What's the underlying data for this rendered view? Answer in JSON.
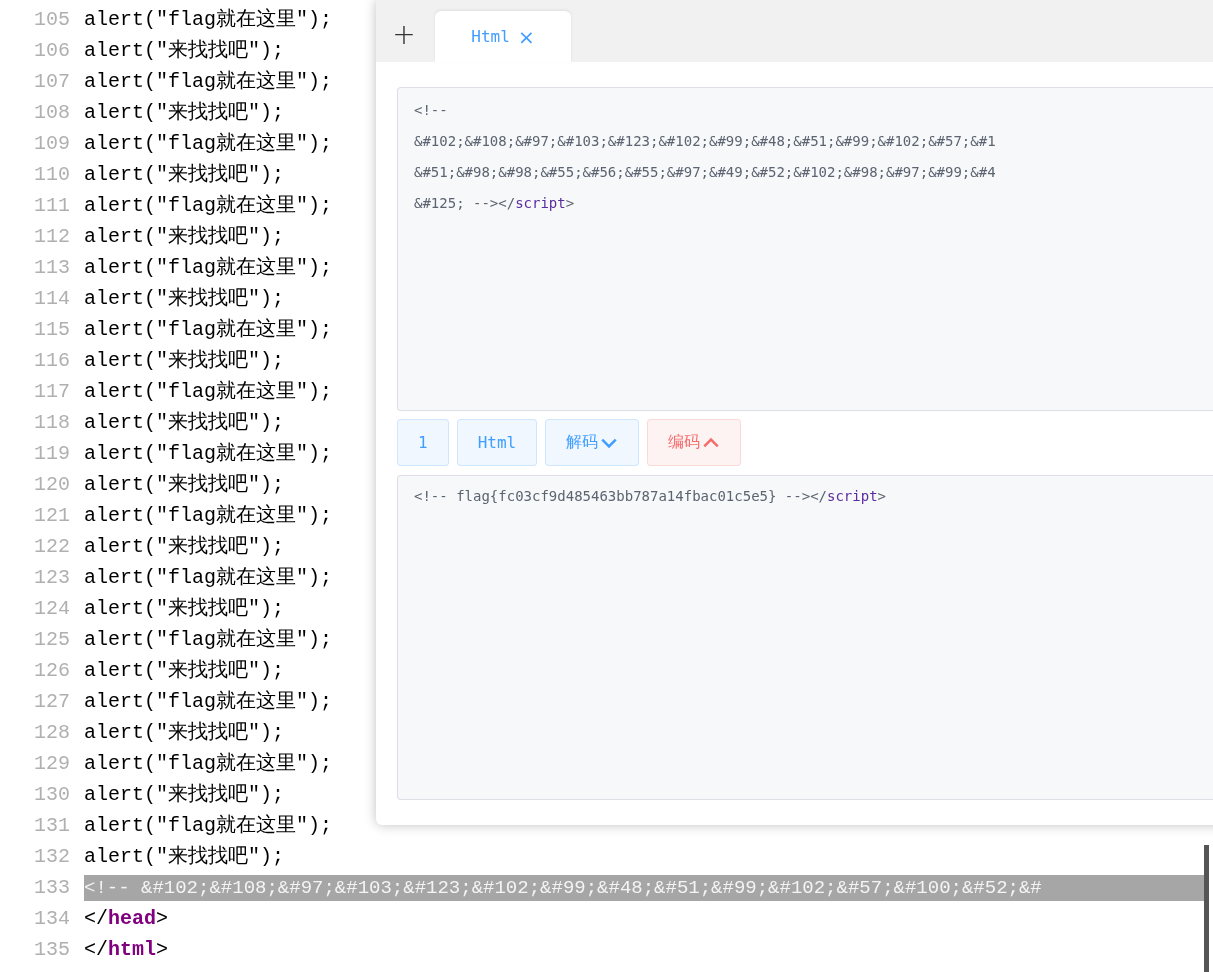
{
  "editor": {
    "lines": [
      {
        "number": "105",
        "selected": false,
        "segments": [
          {
            "kind": "plain",
            "text": "alert(\"flag就在这里\");"
          }
        ]
      },
      {
        "number": "106",
        "selected": false,
        "segments": [
          {
            "kind": "plain",
            "text": "alert(\"来找找吧\");"
          }
        ]
      },
      {
        "number": "107",
        "selected": false,
        "segments": [
          {
            "kind": "plain",
            "text": "alert(\"flag就在这里\");"
          }
        ]
      },
      {
        "number": "108",
        "selected": false,
        "segments": [
          {
            "kind": "plain",
            "text": "alert(\"来找找吧\");"
          }
        ]
      },
      {
        "number": "109",
        "selected": false,
        "segments": [
          {
            "kind": "plain",
            "text": "alert(\"flag就在这里\");"
          }
        ]
      },
      {
        "number": "110",
        "selected": false,
        "segments": [
          {
            "kind": "plain",
            "text": "alert(\"来找找吧\");"
          }
        ]
      },
      {
        "number": "111",
        "selected": false,
        "segments": [
          {
            "kind": "plain",
            "text": "alert(\"flag就在这里\");"
          }
        ]
      },
      {
        "number": "112",
        "selected": false,
        "segments": [
          {
            "kind": "plain",
            "text": "alert(\"来找找吧\");"
          }
        ]
      },
      {
        "number": "113",
        "selected": false,
        "segments": [
          {
            "kind": "plain",
            "text": "alert(\"flag就在这里\");"
          }
        ]
      },
      {
        "number": "114",
        "selected": false,
        "segments": [
          {
            "kind": "plain",
            "text": "alert(\"来找找吧\");"
          }
        ]
      },
      {
        "number": "115",
        "selected": false,
        "segments": [
          {
            "kind": "plain",
            "text": "alert(\"flag就在这里\");"
          }
        ]
      },
      {
        "number": "116",
        "selected": false,
        "segments": [
          {
            "kind": "plain",
            "text": "alert(\"来找找吧\");"
          }
        ]
      },
      {
        "number": "117",
        "selected": false,
        "segments": [
          {
            "kind": "plain",
            "text": "alert(\"flag就在这里\");"
          }
        ]
      },
      {
        "number": "118",
        "selected": false,
        "segments": [
          {
            "kind": "plain",
            "text": "alert(\"来找找吧\");"
          }
        ]
      },
      {
        "number": "119",
        "selected": false,
        "segments": [
          {
            "kind": "plain",
            "text": "alert(\"flag就在这里\");"
          }
        ]
      },
      {
        "number": "120",
        "selected": false,
        "segments": [
          {
            "kind": "plain",
            "text": "alert(\"来找找吧\");"
          }
        ]
      },
      {
        "number": "121",
        "selected": false,
        "segments": [
          {
            "kind": "plain",
            "text": "alert(\"flag就在这里\");"
          }
        ]
      },
      {
        "number": "122",
        "selected": false,
        "segments": [
          {
            "kind": "plain",
            "text": "alert(\"来找找吧\");"
          }
        ]
      },
      {
        "number": "123",
        "selected": false,
        "segments": [
          {
            "kind": "plain",
            "text": "alert(\"flag就在这里\");"
          }
        ]
      },
      {
        "number": "124",
        "selected": false,
        "segments": [
          {
            "kind": "plain",
            "text": "alert(\"来找找吧\");"
          }
        ]
      },
      {
        "number": "125",
        "selected": false,
        "segments": [
          {
            "kind": "plain",
            "text": "alert(\"flag就在这里\");"
          }
        ]
      },
      {
        "number": "126",
        "selected": false,
        "segments": [
          {
            "kind": "plain",
            "text": "alert(\"来找找吧\");"
          }
        ]
      },
      {
        "number": "127",
        "selected": false,
        "segments": [
          {
            "kind": "plain",
            "text": "alert(\"flag就在这里\");"
          }
        ]
      },
      {
        "number": "128",
        "selected": false,
        "segments": [
          {
            "kind": "plain",
            "text": "alert(\"来找找吧\");"
          }
        ]
      },
      {
        "number": "129",
        "selected": false,
        "segments": [
          {
            "kind": "plain",
            "text": "alert(\"flag就在这里\");"
          }
        ]
      },
      {
        "number": "130",
        "selected": false,
        "segments": [
          {
            "kind": "plain",
            "text": "alert(\"来找找吧\");"
          }
        ]
      },
      {
        "number": "131",
        "selected": false,
        "segments": [
          {
            "kind": "plain",
            "text": "alert(\"flag就在这里\");"
          }
        ]
      },
      {
        "number": "132",
        "selected": false,
        "segments": [
          {
            "kind": "plain",
            "text": "alert(\"来找找吧\");"
          }
        ]
      },
      {
        "number": "133",
        "selected": true,
        "segments": [
          {
            "kind": "plain",
            "text": "<!-- &#102;&#108;&#97;&#103;&#123;&#102;&#99;&#48;&#51;&#99;&#102;&#57;&#100;&#52;&#"
          }
        ]
      },
      {
        "number": "134",
        "selected": false,
        "segments": [
          {
            "kind": "plain",
            "text": "</"
          },
          {
            "kind": "tag",
            "text": "head"
          },
          {
            "kind": "plain",
            "text": ">"
          }
        ]
      },
      {
        "number": "135",
        "selected": false,
        "segments": [
          {
            "kind": "plain",
            "text": "</"
          },
          {
            "kind": "tag",
            "text": "html"
          },
          {
            "kind": "plain",
            "text": ">"
          }
        ]
      }
    ]
  },
  "panel": {
    "add_label": "+",
    "tabs": [
      {
        "label": "Html",
        "close": "×",
        "selected": true
      }
    ],
    "input": {
      "lines": [
        [
          {
            "kind": "plain",
            "text": "<!--"
          }
        ],
        [
          {
            "kind": "plain",
            "text": "&#102;&#108;&#97;&#103;&#123;&#102;&#99;&#48;&#51;&#99;&#102;&#57;&#1"
          }
        ],
        [
          {
            "kind": "plain",
            "text": "&#51;&#98;&#98;&#55;&#56;&#55;&#97;&#49;&#52;&#102;&#98;&#97;&#99;&#4"
          }
        ],
        [
          {
            "kind": "plain",
            "text": "&#125; --></"
          },
          {
            "kind": "tag",
            "text": "script"
          },
          {
            "kind": "plain",
            "text": ">"
          }
        ]
      ]
    },
    "buttons": [
      {
        "label": "1",
        "kind": "plain",
        "color": "#409eff"
      },
      {
        "label": "Html",
        "kind": "plain",
        "color": "#409eff"
      },
      {
        "label": "解码",
        "kind": "collapsed",
        "color": "#409eff"
      },
      {
        "label": "编码",
        "kind": "expanded",
        "color": "#f56c6c"
      }
    ],
    "output": {
      "lines": [
        [
          {
            "kind": "plain",
            "text": "<!-- flag{fc03cf9d485463bb787a14fbac01c5e5} --></"
          },
          {
            "kind": "tag",
            "text": "script"
          },
          {
            "kind": "plain",
            "text": ">"
          }
        ]
      ]
    }
  }
}
